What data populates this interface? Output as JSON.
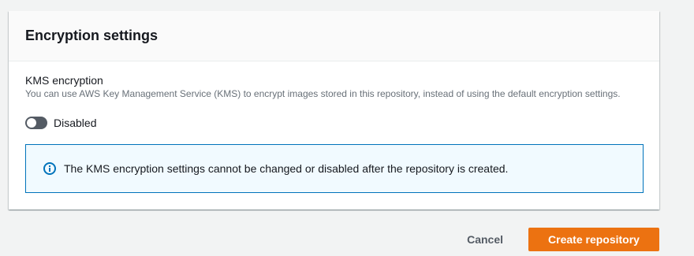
{
  "panel": {
    "title": "Encryption settings"
  },
  "kms": {
    "label": "KMS encryption",
    "description": "You can use AWS Key Management Service (KMS) to encrypt images stored in this repository, instead of using the default encryption settings.",
    "toggle_state": "Disabled",
    "toggle_on": false
  },
  "alert": {
    "icon": "info-icon",
    "text": "The KMS encryption settings cannot be changed or disabled after the repository is created."
  },
  "actions": {
    "cancel_label": "Cancel",
    "create_label": "Create repository"
  },
  "colors": {
    "primary": "#ec7211",
    "info": "#0073bb",
    "info_bg": "#f1faff",
    "toggle_off": "#545b64"
  }
}
